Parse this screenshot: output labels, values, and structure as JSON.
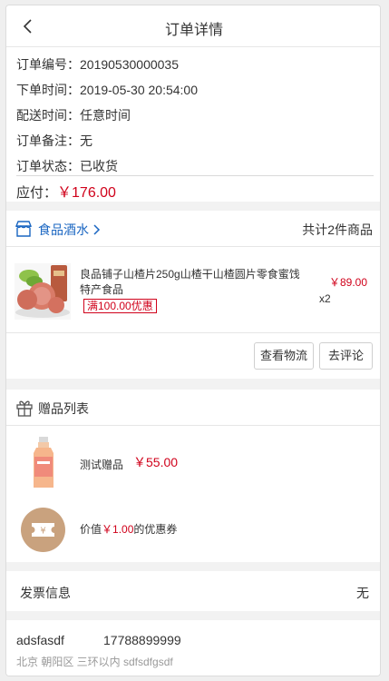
{
  "header": {
    "title": "订单详情",
    "back_icon": "chevron-left-icon"
  },
  "order": {
    "number_label": "订单编号：",
    "number": "20190530000035",
    "time_label": "下单时间：",
    "time": "2019-05-30 20:54:00",
    "delivery_label": "配送时间：",
    "delivery": "任意时间",
    "remark_label": "订单备注：",
    "remark": "无",
    "status_label": "订单状态：",
    "status": "已收货",
    "payable_label": "应付：",
    "payable": "￥176.00"
  },
  "store": {
    "icon": "store-icon",
    "name": "食品酒水",
    "count_text": "共计2件商品"
  },
  "product": {
    "name": "良品铺子山楂片250g山楂干山楂圆片零食蜜饯特产食品",
    "promo": "满100.00优惠",
    "price": "￥89.00",
    "qty": "x2"
  },
  "actions": {
    "logistics": "查看物流",
    "review": "去评论"
  },
  "gifts": {
    "title": "赠品列表",
    "icon": "gift-icon",
    "item_name": "测试赠品",
    "item_price": "￥55.00",
    "coupon_prefix": "价值",
    "coupon_amount": "￥1.00",
    "coupon_suffix": "的优惠券"
  },
  "invoice": {
    "label": "发票信息",
    "value": "无"
  },
  "address": {
    "name": "adsfasdf",
    "phone": "17788899999",
    "detail": "北京 朝阳区 三环以内 sdfsdfgsdf"
  },
  "colors": {
    "price_red": "#d0021b",
    "link_blue": "#1a66c2",
    "coupon_tan": "#c9a27e"
  }
}
